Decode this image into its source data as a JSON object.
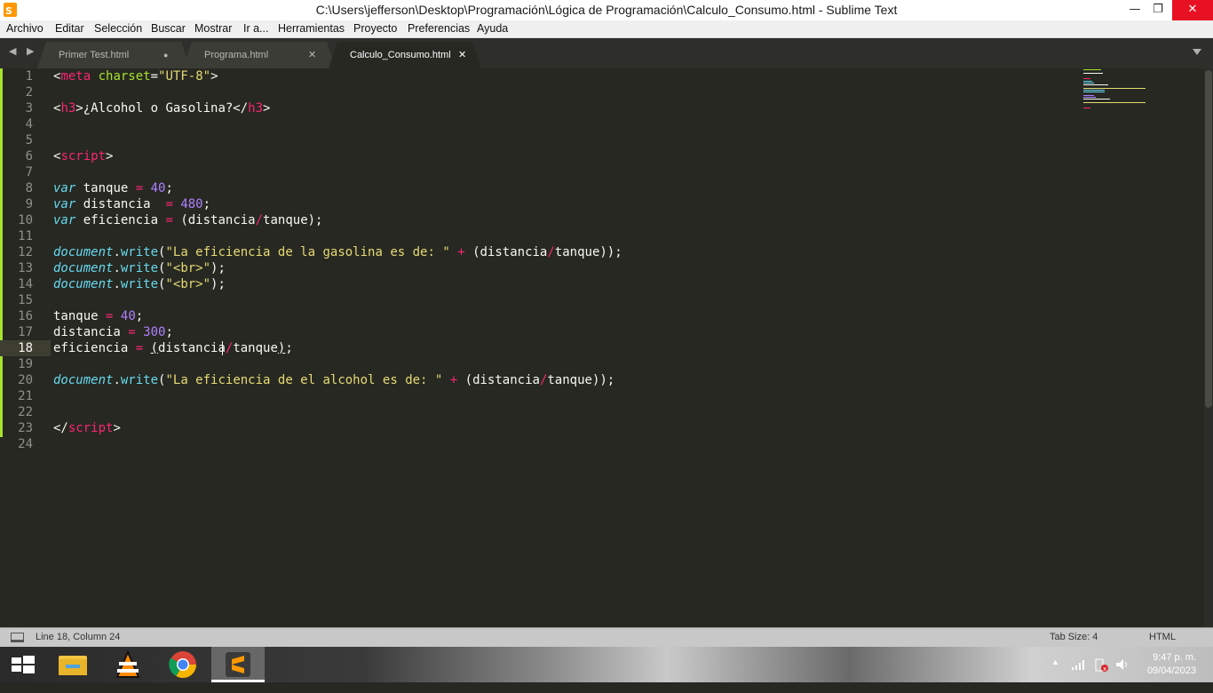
{
  "window": {
    "title": "C:\\Users\\jefferson\\Desktop\\Programación\\Lógica de Programación\\Calculo_Consumo.html - Sublime Text",
    "icon": "sublime-icon",
    "minimize": "—",
    "maximize": "❐",
    "close": "✕"
  },
  "menu": [
    "Archivo",
    "Editar",
    "Selección",
    "Buscar",
    "Mostrar",
    "Ir a...",
    "Herramientas",
    "Proyecto",
    "Preferencias",
    "Ayuda"
  ],
  "tabs": [
    {
      "label": "Primer Test.html",
      "status": "●",
      "active": false
    },
    {
      "label": "Programa.html",
      "status": "✕",
      "active": false
    },
    {
      "label": "Calculo_Consumo.html",
      "status": "✕",
      "active": true
    }
  ],
  "nav_arrows": "◀ ▶",
  "editor": {
    "current_line": 18,
    "line_numbers": [
      "1",
      "2",
      "3",
      "4",
      "5",
      "6",
      "7",
      "8",
      "9",
      "10",
      "11",
      "12",
      "13",
      "14",
      "15",
      "16",
      "17",
      "18",
      "19",
      "20",
      "21",
      "22",
      "23",
      "24"
    ]
  },
  "status": {
    "position": "Line 18, Column 24",
    "tab_size": "Tab Size: 4",
    "syntax": "HTML"
  },
  "taskbar": {
    "items": [
      "start-button",
      "file-explorer",
      "vlc",
      "chrome",
      "sublime-text"
    ],
    "time": "9:47 p. m.",
    "date": "09/04/2023"
  },
  "colors": {
    "background": "#272822",
    "tag": "#f92672",
    "attr": "#a6e22e",
    "string": "#e6db74",
    "keyword": "#66d9ef",
    "number": "#ae81ff",
    "text": "#f8f8f2"
  }
}
